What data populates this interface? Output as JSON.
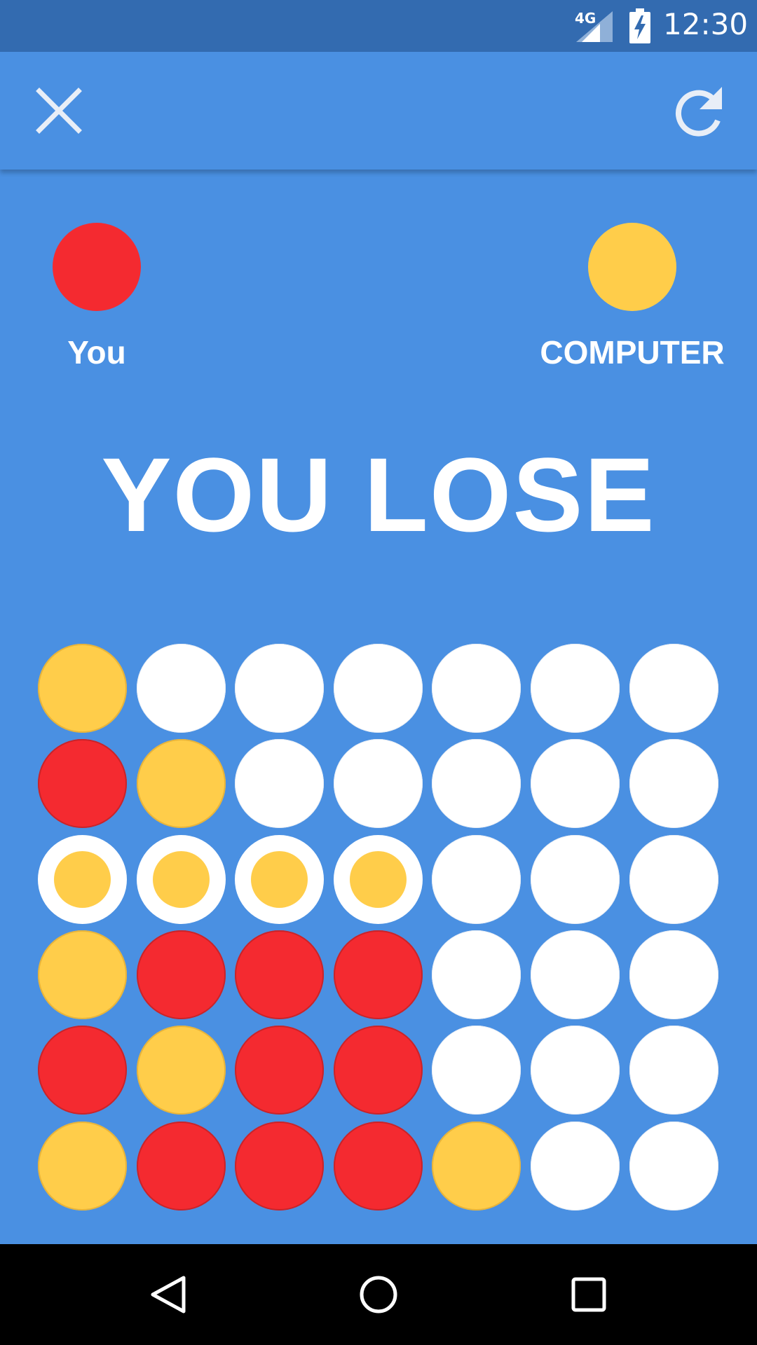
{
  "status_bar": {
    "network": "4G",
    "time": "12:30",
    "icons": [
      "signal-icon",
      "battery-charging-icon"
    ]
  },
  "toolbar": {
    "close_icon": "close-icon",
    "restart_icon": "refresh-icon"
  },
  "players": {
    "you": {
      "label": "You",
      "color": "#f42a30"
    },
    "computer": {
      "label": "COMPUTER",
      "color": "#ffcd4a"
    }
  },
  "result": {
    "message": "YOU LOSE"
  },
  "board": {
    "columns": 7,
    "rows": 6,
    "colors": {
      "red": "#f42a30",
      "yellow": "#ffcd4a",
      "empty": "#ffffff"
    },
    "cells": [
      [
        "yellow",
        "empty",
        "empty",
        "empty",
        "empty",
        "empty",
        "empty"
      ],
      [
        "red",
        "yellow",
        "empty",
        "empty",
        "empty",
        "empty",
        "empty"
      ],
      [
        "yellow-win",
        "yellow-win",
        "yellow-win",
        "yellow-win",
        "empty",
        "empty",
        "empty"
      ],
      [
        "yellow",
        "red",
        "red",
        "red",
        "empty",
        "empty",
        "empty"
      ],
      [
        "red",
        "yellow",
        "red",
        "red",
        "empty",
        "empty",
        "empty"
      ],
      [
        "yellow",
        "red",
        "red",
        "red",
        "yellow",
        "empty",
        "empty"
      ]
    ]
  },
  "nav_bar": {
    "back_icon": "back-triangle-icon",
    "home_icon": "home-circle-icon",
    "recents_icon": "recents-square-icon"
  }
}
